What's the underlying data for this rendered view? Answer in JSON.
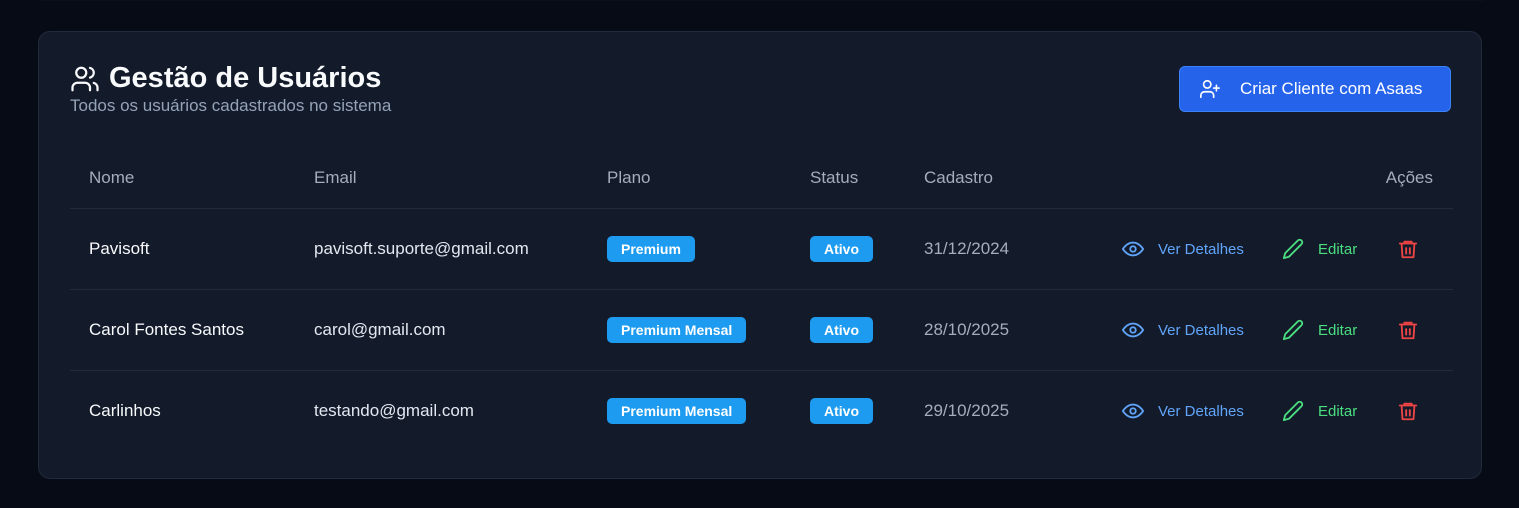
{
  "header": {
    "title": "Gestão de Usuários",
    "subtitle": "Todos os usuários cadastrados no sistema",
    "create_button_label": "Criar Cliente com Asaas",
    "title_icon": "users-icon",
    "button_icon": "user-plus-icon"
  },
  "table": {
    "columns": {
      "name": "Nome",
      "email": "Email",
      "plan": "Plano",
      "status": "Status",
      "created": "Cadastro",
      "actions": "Ações"
    },
    "rows": [
      {
        "name": "Pavisoft",
        "email": "pavisoft.suporte@gmail.com",
        "plan": "Premium",
        "status": "Ativo",
        "created": "31/12/2024",
        "view_label": "Ver Detalhes",
        "edit_label": "Editar"
      },
      {
        "name": "Carol Fontes Santos",
        "email": "carol@gmail.com",
        "plan": "Premium Mensal",
        "status": "Ativo",
        "created": "28/10/2025",
        "view_label": "Ver Detalhes",
        "edit_label": "Editar"
      },
      {
        "name": "Carlinhos",
        "email": "testando@gmail.com",
        "plan": "Premium Mensal",
        "status": "Ativo",
        "created": "29/10/2025",
        "view_label": "Ver Detalhes",
        "edit_label": "Editar"
      }
    ]
  },
  "colors": {
    "page_background": "#060b16",
    "card_background": "#131a2a",
    "primary_button": "#2563eb",
    "badge": "#1d9bf0",
    "view_action": "#60a5fa",
    "edit_action": "#4ade80",
    "delete_action": "#ef4444"
  },
  "icons": {
    "view": "eye-icon",
    "edit": "pencil-icon",
    "delete": "trash-icon"
  }
}
